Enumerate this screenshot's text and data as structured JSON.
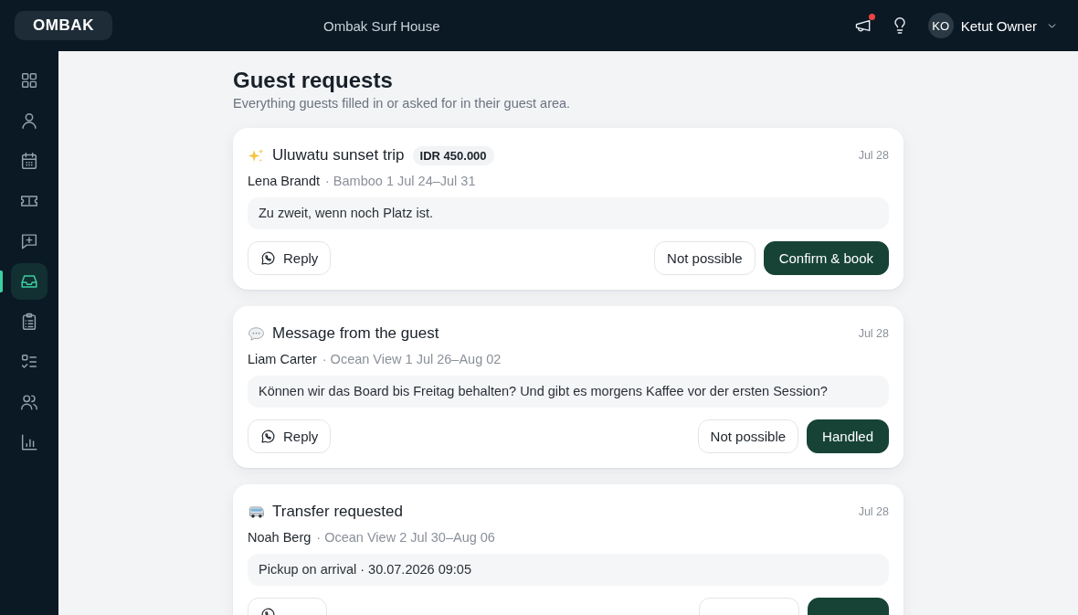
{
  "top_bar": {
    "logo": "OMBAK",
    "property": "Ombak Surf House",
    "announcements_unread": true,
    "user": {
      "initials": "KO",
      "name": "Ketut Owner"
    }
  },
  "sidebar": {
    "items": [
      {
        "kind": "dashboard",
        "selected": false
      },
      {
        "kind": "guests",
        "selected": false
      },
      {
        "kind": "calendar",
        "selected": false
      },
      {
        "kind": "tickets",
        "selected": false
      },
      {
        "kind": "messages",
        "selected": false
      },
      {
        "kind": "inbox",
        "selected": true
      },
      {
        "kind": "tasks",
        "selected": false
      },
      {
        "kind": "checklist",
        "selected": false
      },
      {
        "kind": "team",
        "selected": false
      },
      {
        "kind": "reports",
        "selected": false
      }
    ]
  },
  "header": {
    "title": "Guest requests",
    "subtitle": "Everything guests filled in or asked for in their guest area."
  },
  "requests": [
    {
      "kind": "excursion",
      "title": "Uluwatu sunset trip",
      "price": "IDR 450.000",
      "date": "Jul 28",
      "guest": "Lena Brandt",
      "stay": "· Bamboo 1 Jul 24–Jul 31",
      "message": "Zu zweit, wenn noch Platz ist.",
      "actions": [
        {
          "kind": "reply",
          "label": "Reply"
        },
        {
          "kind": "decline",
          "label": "Not possible"
        },
        {
          "kind": "confirm",
          "label": "Confirm & book"
        }
      ]
    },
    {
      "kind": "message",
      "title": "Message from the guest",
      "date": "Jul 28",
      "guest": "Liam Carter",
      "stay": "· Ocean View 1 Jul 26–Aug 02",
      "message": "Können wir das Board bis Freitag behalten? Und gibt es morgens Kaffee vor der ersten Session?",
      "actions": [
        {
          "kind": "reply",
          "label": "Reply"
        },
        {
          "kind": "decline",
          "label": "Not possible"
        },
        {
          "kind": "resolve",
          "label": "Handled"
        }
      ]
    },
    {
      "kind": "transfer",
      "title": "Transfer requested",
      "date": "Jul 28",
      "guest": "Noah Berg",
      "stay": "· Ocean View 2 Jul 30–Aug 06",
      "message": "Pickup on arrival · 30.07.2026 09:05",
      "actions": [
        {
          "kind": "reply"
        },
        {
          "kind": "decline"
        },
        {
          "kind": "resolve"
        }
      ]
    }
  ]
}
